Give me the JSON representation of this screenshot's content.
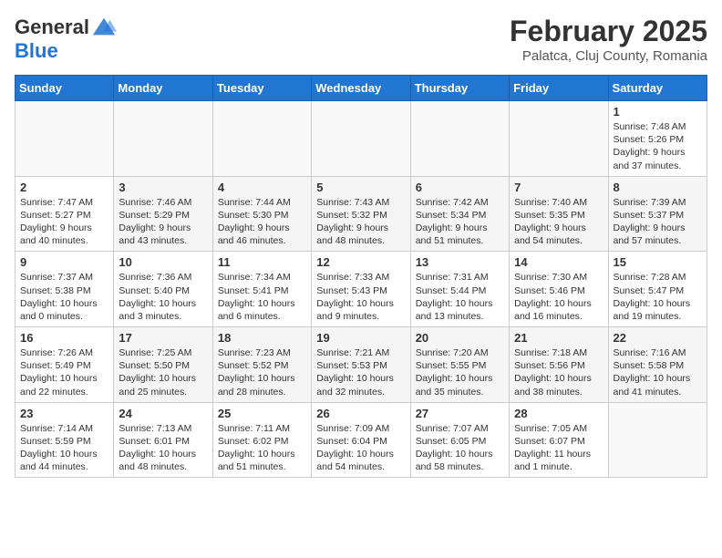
{
  "header": {
    "logo_line1": "General",
    "logo_line2": "Blue",
    "month_year": "February 2025",
    "location": "Palatca, Cluj County, Romania"
  },
  "weekdays": [
    "Sunday",
    "Monday",
    "Tuesday",
    "Wednesday",
    "Thursday",
    "Friday",
    "Saturday"
  ],
  "weeks": [
    [
      {
        "day": "",
        "info": ""
      },
      {
        "day": "",
        "info": ""
      },
      {
        "day": "",
        "info": ""
      },
      {
        "day": "",
        "info": ""
      },
      {
        "day": "",
        "info": ""
      },
      {
        "day": "",
        "info": ""
      },
      {
        "day": "1",
        "info": "Sunrise: 7:48 AM\nSunset: 5:26 PM\nDaylight: 9 hours and 37 minutes."
      }
    ],
    [
      {
        "day": "2",
        "info": "Sunrise: 7:47 AM\nSunset: 5:27 PM\nDaylight: 9 hours and 40 minutes."
      },
      {
        "day": "3",
        "info": "Sunrise: 7:46 AM\nSunset: 5:29 PM\nDaylight: 9 hours and 43 minutes."
      },
      {
        "day": "4",
        "info": "Sunrise: 7:44 AM\nSunset: 5:30 PM\nDaylight: 9 hours and 46 minutes."
      },
      {
        "day": "5",
        "info": "Sunrise: 7:43 AM\nSunset: 5:32 PM\nDaylight: 9 hours and 48 minutes."
      },
      {
        "day": "6",
        "info": "Sunrise: 7:42 AM\nSunset: 5:34 PM\nDaylight: 9 hours and 51 minutes."
      },
      {
        "day": "7",
        "info": "Sunrise: 7:40 AM\nSunset: 5:35 PM\nDaylight: 9 hours and 54 minutes."
      },
      {
        "day": "8",
        "info": "Sunrise: 7:39 AM\nSunset: 5:37 PM\nDaylight: 9 hours and 57 minutes."
      }
    ],
    [
      {
        "day": "9",
        "info": "Sunrise: 7:37 AM\nSunset: 5:38 PM\nDaylight: 10 hours and 0 minutes."
      },
      {
        "day": "10",
        "info": "Sunrise: 7:36 AM\nSunset: 5:40 PM\nDaylight: 10 hours and 3 minutes."
      },
      {
        "day": "11",
        "info": "Sunrise: 7:34 AM\nSunset: 5:41 PM\nDaylight: 10 hours and 6 minutes."
      },
      {
        "day": "12",
        "info": "Sunrise: 7:33 AM\nSunset: 5:43 PM\nDaylight: 10 hours and 9 minutes."
      },
      {
        "day": "13",
        "info": "Sunrise: 7:31 AM\nSunset: 5:44 PM\nDaylight: 10 hours and 13 minutes."
      },
      {
        "day": "14",
        "info": "Sunrise: 7:30 AM\nSunset: 5:46 PM\nDaylight: 10 hours and 16 minutes."
      },
      {
        "day": "15",
        "info": "Sunrise: 7:28 AM\nSunset: 5:47 PM\nDaylight: 10 hours and 19 minutes."
      }
    ],
    [
      {
        "day": "16",
        "info": "Sunrise: 7:26 AM\nSunset: 5:49 PM\nDaylight: 10 hours and 22 minutes."
      },
      {
        "day": "17",
        "info": "Sunrise: 7:25 AM\nSunset: 5:50 PM\nDaylight: 10 hours and 25 minutes."
      },
      {
        "day": "18",
        "info": "Sunrise: 7:23 AM\nSunset: 5:52 PM\nDaylight: 10 hours and 28 minutes."
      },
      {
        "day": "19",
        "info": "Sunrise: 7:21 AM\nSunset: 5:53 PM\nDaylight: 10 hours and 32 minutes."
      },
      {
        "day": "20",
        "info": "Sunrise: 7:20 AM\nSunset: 5:55 PM\nDaylight: 10 hours and 35 minutes."
      },
      {
        "day": "21",
        "info": "Sunrise: 7:18 AM\nSunset: 5:56 PM\nDaylight: 10 hours and 38 minutes."
      },
      {
        "day": "22",
        "info": "Sunrise: 7:16 AM\nSunset: 5:58 PM\nDaylight: 10 hours and 41 minutes."
      }
    ],
    [
      {
        "day": "23",
        "info": "Sunrise: 7:14 AM\nSunset: 5:59 PM\nDaylight: 10 hours and 44 minutes."
      },
      {
        "day": "24",
        "info": "Sunrise: 7:13 AM\nSunset: 6:01 PM\nDaylight: 10 hours and 48 minutes."
      },
      {
        "day": "25",
        "info": "Sunrise: 7:11 AM\nSunset: 6:02 PM\nDaylight: 10 hours and 51 minutes."
      },
      {
        "day": "26",
        "info": "Sunrise: 7:09 AM\nSunset: 6:04 PM\nDaylight: 10 hours and 54 minutes."
      },
      {
        "day": "27",
        "info": "Sunrise: 7:07 AM\nSunset: 6:05 PM\nDaylight: 10 hours and 58 minutes."
      },
      {
        "day": "28",
        "info": "Sunrise: 7:05 AM\nSunset: 6:07 PM\nDaylight: 11 hours and 1 minute."
      },
      {
        "day": "",
        "info": ""
      }
    ]
  ]
}
